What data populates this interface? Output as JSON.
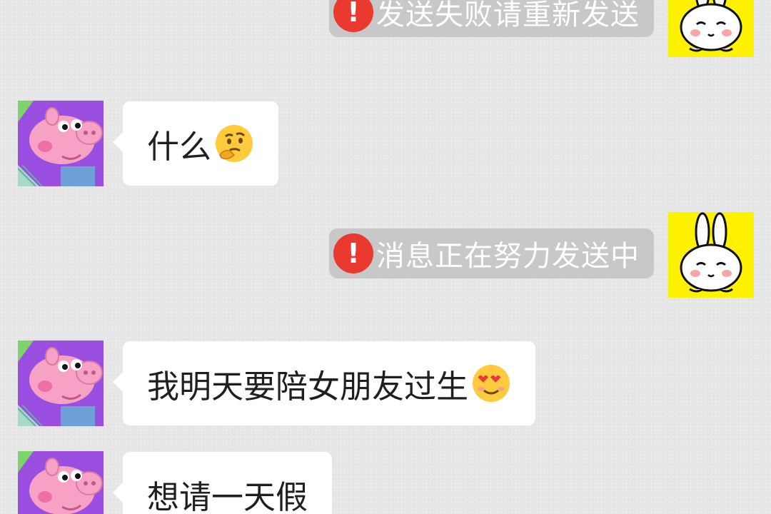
{
  "messages": [
    {
      "side": "out",
      "text": "发送失败请重新发送",
      "status": "failed",
      "status_glyph": "!"
    },
    {
      "side": "in",
      "text": "什么",
      "emoji": "thinking-face-emoji"
    },
    {
      "side": "out",
      "text": "消息正在努力发送中",
      "status": "sending",
      "status_glyph": "!"
    },
    {
      "side": "in",
      "text": "我明天要陪女朋友过生",
      "emoji": "heart-eyes-emoji"
    },
    {
      "side": "in",
      "text": "想请一天假"
    }
  ],
  "avatars": {
    "contact": "pig-avatar",
    "self": "bunny-avatar"
  },
  "colors": {
    "background": "#e6e6e6",
    "incoming_bubble": "#ffffff",
    "outgoing_pill": "#c8c8c8",
    "error_badge": "#ea3a30",
    "bunny_bg": "#fff200",
    "pig_bg": "#9b4fe0"
  }
}
